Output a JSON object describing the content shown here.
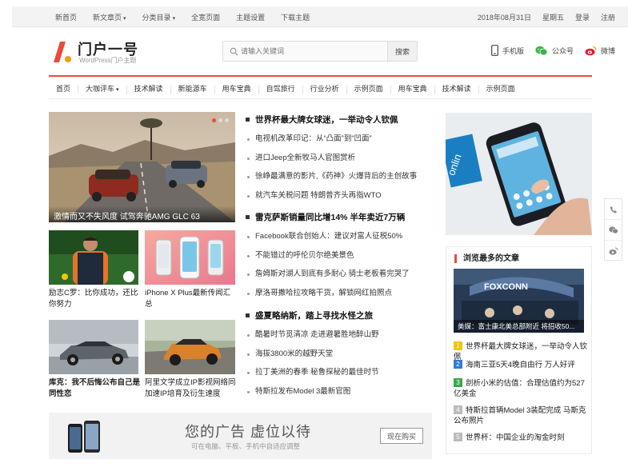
{
  "topbar": {
    "links": [
      {
        "label": "新首页"
      },
      {
        "label": "新文章页",
        "caret": "▾"
      },
      {
        "label": "分类目录",
        "caret": "▾"
      },
      {
        "label": "全宽页面"
      },
      {
        "label": "主题设置"
      },
      {
        "label": "下载主题"
      }
    ],
    "date": "2018年08月31日",
    "weekday": "星期五",
    "login": "登录",
    "register": "注册"
  },
  "header": {
    "site_title": "门户一号",
    "site_subtitle": "WordPress门户主题",
    "search_placeholder": "请输入关键词",
    "search_button": "搜索",
    "mobile": "手机版",
    "wechat": "公众号",
    "weibo": "微博"
  },
  "nav": [
    "首页",
    "大咖评车",
    "技术解读",
    "新能源车",
    "用车宝典",
    "自驾旅行",
    "行业分析",
    "示例页面",
    "用车宝典",
    "技术解读",
    "示例页面"
  ],
  "nav_caret": "▾",
  "hero": {
    "caption": "激情而又不失风度 试驾奔驰AMG GLC 63"
  },
  "thumbs": [
    {
      "caption": "励志C罗：比你成功，还比你努力"
    },
    {
      "caption": "iPhone X Plus最新传闻汇总"
    },
    {
      "caption": "库克：我不后悔公布自己是同性恋"
    },
    {
      "caption": "阿里文学成立IP影视网络同加速IP培育及衍生速度"
    }
  ],
  "news_groups": [
    {
      "headline": "世界杯最大牌女球迷，一举动令人钦佩",
      "items": [
        "电视机改革印记：从“凸面”到“凹面”",
        "进口Jeep全新牧马人官图赏析",
        "徐峥最满意的影片,《药神》火爆背后的主创故事",
        "就汽车关税问题 特朗普齐头再指WTO"
      ]
    },
    {
      "headline": "雷克萨斯销量同比增14% 半年卖近7万辆",
      "items": [
        "Facebook联合创始人：建议对富人征税50%",
        "不能错过的呼伦贝尔绝美景色",
        "詹姆斯对湖人到底有多耐心 骑士老板看完哭了",
        "摩洛哥撒哈拉攻略干货，解锁网红拍照点"
      ]
    },
    {
      "headline": "盛夏略纳斯，踏上寻找水怪之旅",
      "items": [
        "酷暑时节觅清凉 走进避暑胜地醉山野",
        "海拔3800米的越野天堂",
        "拉丁美洲的春季 秘鲁探秘的最佳时节",
        "特斯拉发布Model 3最新官图"
      ]
    }
  ],
  "ad": {
    "title": "您的广告 虚位以待",
    "subtitle": "可在电脑、平板、手机中自适应调整",
    "button": "现在购买"
  },
  "side_ad": {
    "text": "onlin"
  },
  "popular": {
    "title": "浏览最多的文章",
    "banner_word": "FOXCONN",
    "image_caption": "美媒：富士康北美总部附近 将招收50...",
    "items": [
      {
        "num": "1",
        "text": "世界杯最大牌女球迷，一举动令人钦佩",
        "color": "#f1c40f"
      },
      {
        "num": "2",
        "text": "海南三亚5天4晚自由行 万人好评",
        "color": "#2e7bd6"
      },
      {
        "num": "3",
        "text": "剖析小米的估值：合理估值约为527亿美金",
        "color": "#3aa84b"
      },
      {
        "num": "4",
        "text": "特斯拉首辆Model 3装配完成 马斯克公布照片",
        "color": "#bbbbbb"
      },
      {
        "num": "5",
        "text": "世界杯：中国企业的淘金时刻",
        "color": "#bbbbbb"
      }
    ]
  },
  "colors": {
    "accent": "#e74c3c",
    "logo_orange": "#f39c12"
  }
}
